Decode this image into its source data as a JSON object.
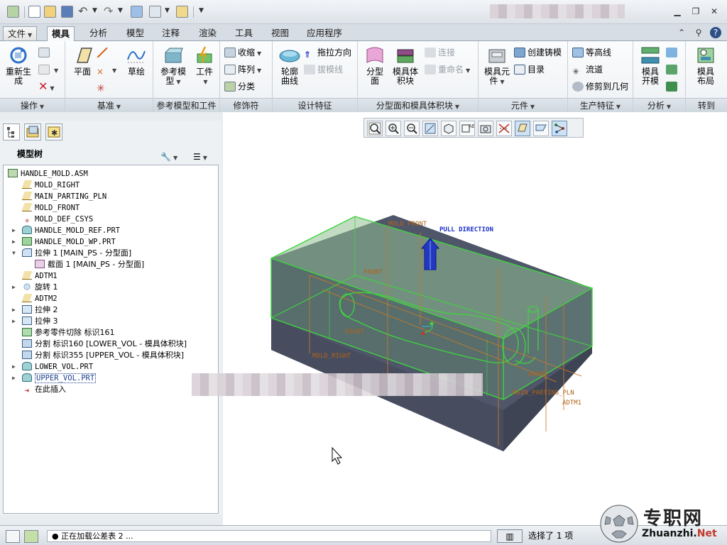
{
  "quick_access": {
    "items": [
      "new-icon",
      "open-icon",
      "save-icon",
      "undo-icon",
      "redo-icon",
      "regenerate-icon",
      "windows-icon",
      "close-window-icon"
    ]
  },
  "menu": {
    "file_label": "文件",
    "tabs": [
      "模具",
      "分析",
      "模型",
      "注释",
      "渲染",
      "工具",
      "视图",
      "应用程序"
    ]
  },
  "ribbon": {
    "operations": {
      "regenerate": "重新生\n成",
      "label": "操作"
    },
    "datum": {
      "plane": "平面",
      "sketch": "草绘",
      "label": "基准"
    },
    "ref_model": {
      "ref_model": "参考模\n型",
      "workpiece": "工件",
      "label": "参考模型和工件"
    },
    "decoration": {
      "shrink": "收缩",
      "pattern": "阵列",
      "classify": "分类",
      "label": "修饰符"
    },
    "design": {
      "contour_curve": "轮廓\n曲线",
      "drag_direction": "拖拉方向",
      "draft_line": "拔模线",
      "label": "设计特征"
    },
    "parting": {
      "parting_surface": "分型\n面",
      "mold_volume": "模具体\n积块",
      "connect": "连接",
      "rename": "重命名",
      "label": "分型面和模具体积块"
    },
    "component": {
      "mold_component": "模具元\n件",
      "create_casting": "创建铸模",
      "directory": "目录",
      "label": "元件"
    },
    "production": {
      "contour_line": "等高线",
      "flow": "流道",
      "trim_geometry": "修剪到几何",
      "label": "生产特征"
    },
    "analysis": {
      "mold_open": "模具\n开模",
      "label": "分析"
    },
    "goto": {
      "mold_layout": "模具\n布局",
      "label": "转到"
    }
  },
  "model_tree": {
    "title": "模型树",
    "items": [
      {
        "label": "HANDLE_MOLD.ASM",
        "icon": "assembly-icon",
        "level": 0,
        "toggle": ""
      },
      {
        "label": "MOLD_RIGHT",
        "icon": "datum-plane-icon",
        "level": 1,
        "toggle": ""
      },
      {
        "label": "MAIN_PARTING_PLN",
        "icon": "datum-plane-icon",
        "level": 1,
        "toggle": ""
      },
      {
        "label": "MOLD_FRONT",
        "icon": "datum-plane-icon",
        "level": 1,
        "toggle": ""
      },
      {
        "label": "MOLD_DEF_CSYS",
        "icon": "csys-icon",
        "level": 1,
        "toggle": ""
      },
      {
        "label": "HANDLE_MOLD_REF.PRT",
        "icon": "part-icon",
        "level": 1,
        "toggle": "▶"
      },
      {
        "label": "HANDLE_MOLD_WP.PRT",
        "icon": "workpiece-icon",
        "level": 1,
        "toggle": "▶"
      },
      {
        "label": "拉伸 1 [MAIN_PS - 分型面]",
        "icon": "extrude-surface-icon",
        "level": 1,
        "toggle": "▼"
      },
      {
        "label": "截面 1 [MAIN_PS - 分型面]",
        "icon": "section-icon",
        "level": 2,
        "toggle": ""
      },
      {
        "label": "ADTM1",
        "icon": "datum-plane-icon",
        "level": 1,
        "toggle": ""
      },
      {
        "label": "旋转 1",
        "icon": "revolve-icon",
        "level": 1,
        "toggle": "▶"
      },
      {
        "label": "ADTM2",
        "icon": "datum-plane-icon",
        "level": 1,
        "toggle": ""
      },
      {
        "label": "拉伸 2",
        "icon": "extrude-icon",
        "level": 1,
        "toggle": "▶"
      },
      {
        "label": "拉伸 3",
        "icon": "extrude-icon",
        "level": 1,
        "toggle": "▶"
      },
      {
        "label": "参考零件切除 标识161",
        "icon": "ref-cut-icon",
        "level": 1,
        "toggle": ""
      },
      {
        "label": "分割 标识160 [LOWER_VOL - 模具体积块]",
        "icon": "split-icon",
        "level": 1,
        "toggle": ""
      },
      {
        "label": "分割 标识355 [UPPER_VOL - 模具体积块]",
        "icon": "split-icon",
        "level": 1,
        "toggle": ""
      },
      {
        "label": "LOWER_VOL.PRT",
        "icon": "part-icon",
        "level": 1,
        "toggle": "▶"
      },
      {
        "label": "UPPER_VOL.PRT",
        "icon": "part-icon",
        "level": 1,
        "toggle": "▶",
        "selected": true
      },
      {
        "label": "在此插入",
        "icon": "insert-here-icon",
        "level": 1,
        "toggle": ""
      }
    ]
  },
  "viewport": {
    "labels": {
      "mold_front": "MOLD_FRONT",
      "pull_direction": "PULL DIRECTION",
      "right": "RIGHT",
      "mold_right": "MOLD_RIGHT",
      "front": "FRONT",
      "main_parting_pln": "MAIN_PARTING_PLN",
      "adtm1": "ADTM1",
      "adtm2": "ADTM2"
    },
    "colors": {
      "edge": "#3fd43f",
      "dark_face": "#50566a",
      "pull_arrow": "#1a2fc7",
      "datum_orange": "#c87a26"
    }
  },
  "status": {
    "message": "● 正在加载公差表 2 ...",
    "selection": "选择了 1 项"
  },
  "watermark": {
    "cn": "专职网",
    "en_a": "Zhuanzhi.",
    "en_b": "Net"
  }
}
